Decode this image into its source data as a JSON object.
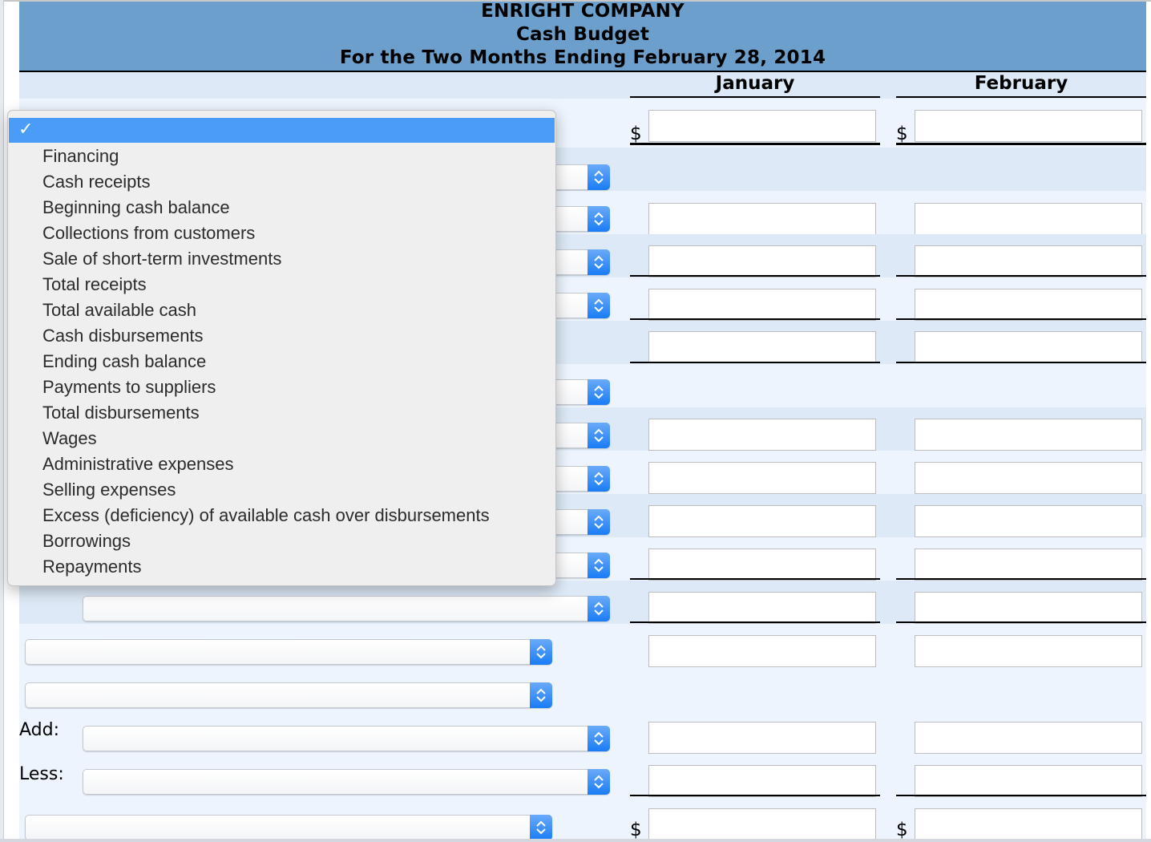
{
  "report": {
    "company": "ENRIGHT COMPANY",
    "title": "Cash Budget",
    "period": "For the Two Months Ending February 28, 2014"
  },
  "columns": {
    "january": "January",
    "february": "February"
  },
  "currency_symbol": "$",
  "row_labels": {
    "add": "Add:",
    "less": "Less:"
  },
  "dropdown_menu": {
    "selected_label": "",
    "check_glyph": "✓",
    "options": [
      "Financing",
      "Cash receipts",
      "Beginning cash balance",
      "Collections from customers",
      "Sale of short-term investments",
      "Total receipts",
      "Total available cash",
      "Cash disbursements",
      "Ending cash balance",
      "Payments to suppliers",
      "Total disbursements",
      "Wages",
      "Administrative expenses",
      "Selling expenses",
      "Excess (deficiency) of available cash over disbursements",
      "Borrowings",
      "Repayments"
    ]
  },
  "rows": [
    {
      "select": "",
      "jan": "",
      "feb": ""
    },
    {
      "select": ""
    },
    {
      "select": "",
      "jan": "",
      "feb": ""
    },
    {
      "select": "",
      "jan": "",
      "feb": ""
    },
    {
      "select": "",
      "jan": "",
      "feb": ""
    },
    {
      "jan": "",
      "feb": ""
    },
    {
      "select": ""
    },
    {
      "select": "",
      "jan": "",
      "feb": ""
    },
    {
      "select": "",
      "jan": "",
      "feb": ""
    },
    {
      "select": "",
      "jan": "",
      "feb": ""
    },
    {
      "select": "",
      "jan": "",
      "feb": ""
    },
    {
      "select": "",
      "jan": "",
      "feb": ""
    },
    {
      "select": "",
      "jan": "",
      "feb": ""
    },
    {
      "select": ""
    },
    {
      "select": "",
      "jan": "",
      "feb": ""
    },
    {
      "select": "",
      "jan": "",
      "feb": ""
    },
    {
      "select": "",
      "jan": "",
      "feb": ""
    }
  ]
}
